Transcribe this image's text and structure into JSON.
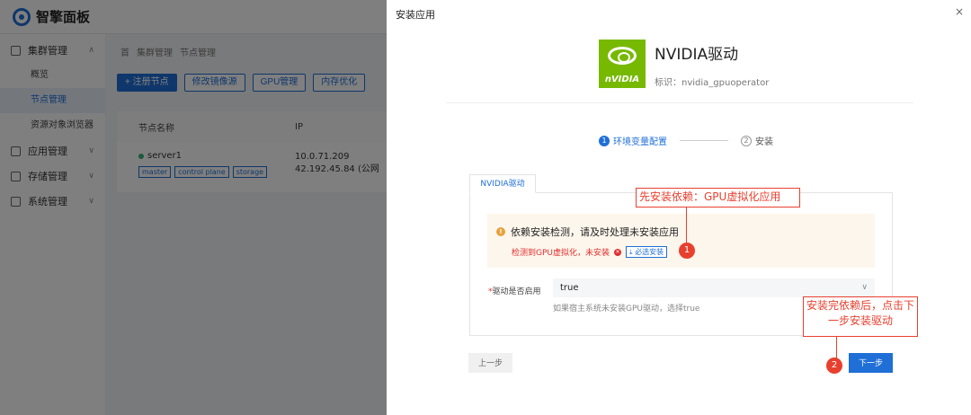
{
  "app": {
    "brand": "智擎面板",
    "sidebar": [
      {
        "label": "集群管理",
        "expanded": true,
        "children": [
          "概览",
          "节点管理",
          "资源对象浏览器"
        ]
      },
      {
        "label": "应用管理"
      },
      {
        "label": "存储管理"
      },
      {
        "label": "系统管理"
      }
    ],
    "active_sub": "节点管理",
    "breadcrumb": [
      "首",
      "集群管理",
      "节点管理"
    ],
    "toolbar": [
      "+ 注册节点",
      "修改镜像源",
      "GPU管理",
      "内存优化"
    ],
    "table": {
      "headers": [
        "节点名称",
        "IP"
      ],
      "rows": [
        {
          "name": "server1",
          "tags": [
            "master",
            "control plane",
            "storage"
          ],
          "ip": [
            "10.0.71.209",
            "42.192.45.84 (公网"
          ]
        }
      ]
    }
  },
  "drawer": {
    "title": "安装应用",
    "close": "×",
    "app_name": "NVIDIA驱动",
    "logo_text": "nVIDIA",
    "app_id": "标识：nvidia_gpuoperator",
    "steps": [
      {
        "num": "1",
        "label": "环境变量配置",
        "active": true
      },
      {
        "num": "2",
        "label": "安装",
        "active": false
      }
    ],
    "tab": "NVIDIA驱动",
    "warning": {
      "title": "依赖安装检测，请及时处理未安装应用",
      "detail": "检测到GPU虚拟化，未安装",
      "link": "必选安装"
    },
    "form": {
      "label": "驱动是否启用",
      "value": "true",
      "hint": "如果宿主系统未安装GPU驱动，选择true"
    },
    "buttons": {
      "prev": "上一步",
      "next": "下一步"
    }
  },
  "annotations": {
    "callout1": "先安装依赖：GPU虚拟化应用",
    "callout2": "安装完依赖后，点击下一步安装驱动",
    "marker1": "1",
    "marker2": "2",
    "color": "#e8402f"
  }
}
